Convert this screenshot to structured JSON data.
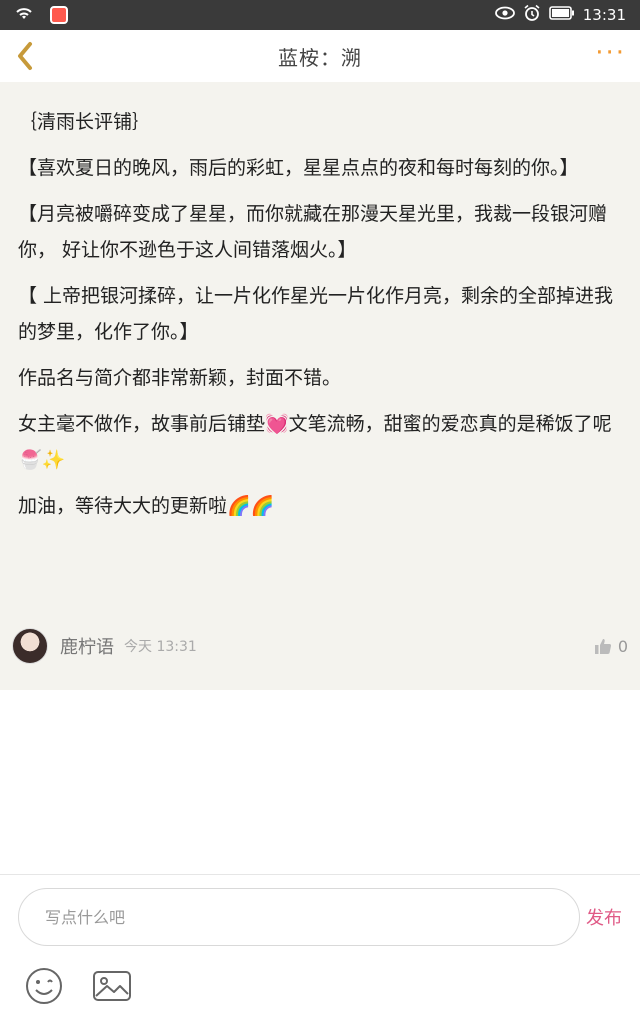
{
  "status_bar": {
    "time": "13:31",
    "icons": [
      "wifi-icon",
      "app-notification-icon",
      "eye-icon",
      "alarm-icon",
      "battery-icon"
    ]
  },
  "header": {
    "title": "蓝桉：溯",
    "back_icon": "chevron-left-icon",
    "more_icon": "more-dots-icon",
    "more_label": "···",
    "accent_color": "#f39a32"
  },
  "post": {
    "paragraphs": [
      "｛清雨长评铺｝",
      "【喜欢夏日的晚风，雨后的彩虹，星星点点的夜和每时每刻的你。】",
      "【月亮被嚼碎变成了星星，而你就藏在那漫天星光里，我裁一段银河赠你， 好让你不逊色于这人间错落烟火。】",
      "【 上帝把银河揉碎，让一片化作星光一片化作月亮，剩余的全部掉进我的梦里，化作了你。】",
      "作品名与简介都非常新颖，封面不错。",
      "女主毫不做作，故事前后铺垫💓文笔流畅，甜蜜的爱恋真的是稀饭了呢🍧✨",
      "加油，等待大大的更新啦🌈🌈"
    ],
    "author": {
      "name": "鹿柠语",
      "time": "今天 13:31",
      "likes": "0"
    }
  },
  "composer": {
    "placeholder": "写点什么吧",
    "send_label": "发布",
    "send_color": "#e05a86",
    "tools": [
      "emoji-icon",
      "image-icon"
    ]
  }
}
